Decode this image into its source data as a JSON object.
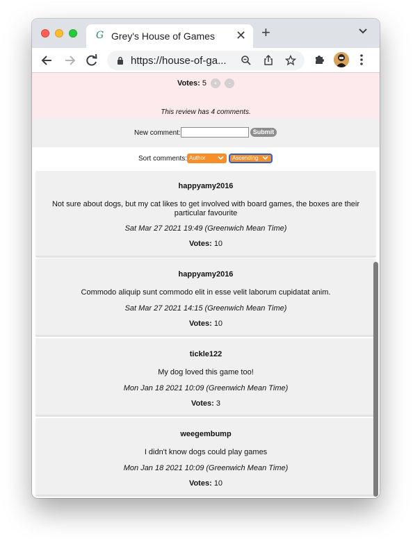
{
  "browser": {
    "tab_title": "Grey's House of Games",
    "favicon_glyph": "G",
    "url": "https://house-of-ga..."
  },
  "review": {
    "votes_label": "Votes:",
    "votes_value": "5",
    "upvote_glyph": "+",
    "downvote_glyph": "-",
    "comment_count_text": "This review has 4 comments."
  },
  "new_comment": {
    "label": "New comment:",
    "input_value": "",
    "submit_label": "Submit"
  },
  "sort": {
    "label": "Sort comments:",
    "field_selected": "Author",
    "order_selected": "Ascending"
  },
  "comments": [
    {
      "author": "happyamy2016",
      "body": "Not sure about dogs, but my cat likes to get involved with board games, the boxes are their particular favourite",
      "date": "Sat Mar 27 2021 19:49 (Greenwich Mean Time)",
      "votes_label": "Votes:",
      "votes": "10"
    },
    {
      "author": "happyamy2016",
      "body": "Commodo aliquip sunt commodo elit in esse velit laborum cupidatat anim.",
      "date": "Sat Mar 27 2021 14:15 (Greenwich Mean Time)",
      "votes_label": "Votes:",
      "votes": "10"
    },
    {
      "author": "tickle122",
      "body": "My dog loved this game too!",
      "date": "Mon Jan 18 2021 10:09 (Greenwich Mean Time)",
      "votes_label": "Votes:",
      "votes": "3"
    },
    {
      "author": "weegembump",
      "body": "I didn't know dogs could play games",
      "date": "Mon Jan 18 2021 10:09 (Greenwich Mean Time)",
      "votes_label": "Votes:",
      "votes": "10"
    }
  ],
  "colors": {
    "review_background": "#fdeaed",
    "card_background": "#f0f0f0",
    "sort_select": "#f68f2b",
    "submit_button": "#8d8d8d"
  }
}
